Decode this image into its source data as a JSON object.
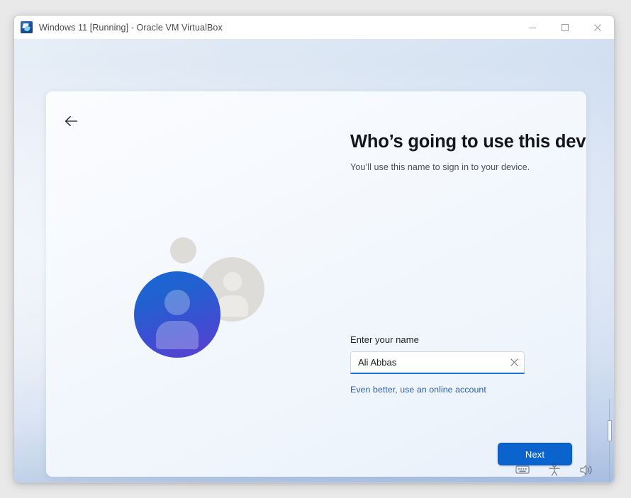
{
  "host_window": {
    "title": "Windows 11 [Running] - Oracle VM VirtualBox",
    "app_icon": "virtualbox-icon",
    "controls": {
      "minimize": "minimize-icon",
      "maximize": "maximize-icon",
      "close": "close-icon"
    }
  },
  "oobe": {
    "back_icon": "back-arrow-icon",
    "title": "Who’s going to use this device?",
    "subtitle": "You’ll use this name to sign in to your device.",
    "illustration": "user-account-illustration",
    "form": {
      "label": "Enter your name",
      "value": "Ali Abbas",
      "placeholder": "",
      "clear_icon": "clear-x-icon"
    },
    "link": "Even better, use an online account",
    "next_label": "Next"
  },
  "tray": {
    "items": [
      {
        "name": "keyboard-icon",
        "label": "Keyboard"
      },
      {
        "name": "accessibility-icon",
        "label": "Accessibility"
      },
      {
        "name": "volume-icon",
        "label": "Volume"
      }
    ]
  },
  "colors": {
    "accent": "#0b63ce",
    "focus_underline": "#1a6fd4",
    "link": "#2b5fa8",
    "title_text": "#14161a",
    "subtitle_text": "#4c5055",
    "avatar_gradient_start": "#1668d4",
    "avatar_gradient_end": "#5b3fd0"
  }
}
